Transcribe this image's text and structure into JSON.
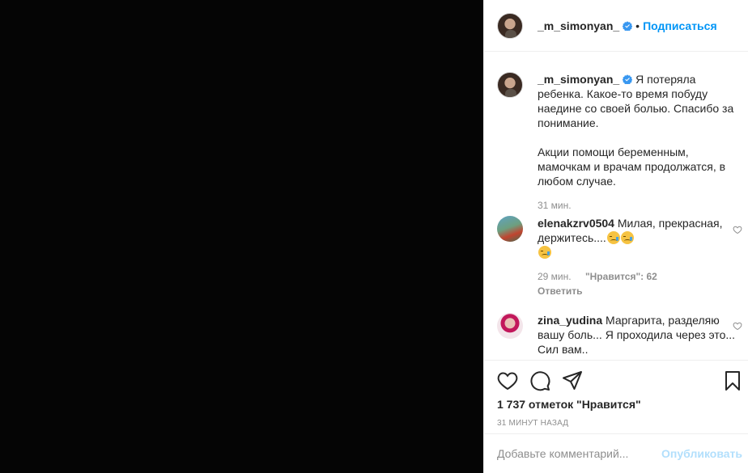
{
  "post": {
    "username": "_m_simonyan_",
    "follow_label": "Подписаться",
    "dot": "•",
    "caption_p1": "Я потеряла ребенка. Какое-то время побуду наедине со своей болью. Спасибо за понимание.",
    "caption_p2": "Акции помощи беременным, мамочкам и врачам продолжатся, в любом случае.",
    "caption_time": "31 мин."
  },
  "comments": [
    {
      "username": "elenakzrv0504",
      "text": "Милая, прекрасная, держитесь....",
      "emojis": [
        "sad-face-emoji",
        "sad-face-emoji",
        "sad-face-emoji"
      ],
      "time": "29 мин.",
      "likes": "\"Нравится\": 62",
      "reply": "Ответить"
    },
    {
      "username": "zina_yudina",
      "text": "Маргарита, разделяю вашу боль... Я проходила через это... Сил вам.."
    }
  ],
  "actions": {
    "icons": [
      "heart-icon",
      "comment-icon",
      "share-icon",
      "bookmark-icon"
    ],
    "likes_count": "1 737 отметок \"Нравится\"",
    "time_ago": "31 МИНУТ НАЗАД"
  },
  "add_comment": {
    "placeholder": "Добавьте комментарий...",
    "publish_label": "Опубликовать"
  },
  "colors": {
    "media_bg": "#050505",
    "accent": "#0095f6",
    "publish_disabled": "#b2dffc",
    "verified": "#3897f0"
  }
}
